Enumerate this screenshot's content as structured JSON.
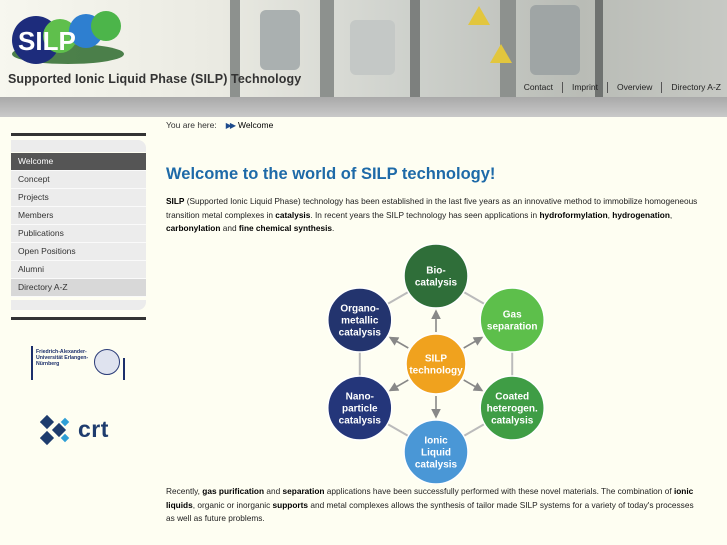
{
  "header": {
    "logo_text": "SILP",
    "site_title": "Supported Ionic Liquid Phase (SILP) Technology",
    "nav": [
      "Contact",
      "Imprint",
      "Overview",
      "Directory A-Z"
    ]
  },
  "breadcrumb": {
    "prefix": "You are here:",
    "current": "Welcome"
  },
  "sidebar": {
    "items": [
      {
        "label": "Welcome"
      },
      {
        "label": "Concept"
      },
      {
        "label": "Projects"
      },
      {
        "label": "Members"
      },
      {
        "label": "Publications"
      },
      {
        "label": "Open Positions"
      },
      {
        "label": "Alumni"
      },
      {
        "label": "Directory A-Z"
      }
    ],
    "fau_logo_text": "Friedrich-Alexander-Universität Erlangen-Nürnberg",
    "crt_logo_text": "crt"
  },
  "main": {
    "title": "Welcome to the world of SILP technology!",
    "p1": [
      {
        "t": "SILP",
        "b": true
      },
      {
        "t": " (Supported Ionic Liquid Phase) technology has been established in the last five years as an innovative method to immobilize homogeneous transition metal complexes in ",
        "b": false
      },
      {
        "t": "catalysis",
        "b": true
      },
      {
        "t": ". In recent years the SILP technology has seen applications in ",
        "b": false
      },
      {
        "t": "hydroformylation",
        "b": true
      },
      {
        "t": ", ",
        "b": false
      },
      {
        "t": "hydrogenation",
        "b": true
      },
      {
        "t": ", ",
        "b": false
      },
      {
        "t": "carbonylation",
        "b": true
      },
      {
        "t": " and ",
        "b": false
      },
      {
        "t": "fine chemical synthesis",
        "b": true
      },
      {
        "t": ".",
        "b": false
      }
    ],
    "p2": [
      {
        "t": "Recently, ",
        "b": false
      },
      {
        "t": "gas purification",
        "b": true
      },
      {
        "t": " and ",
        "b": false
      },
      {
        "t": "separation",
        "b": true
      },
      {
        "t": " applications have been successfully performed with these novel materials. The combination of ",
        "b": false
      },
      {
        "t": "ionic liquids",
        "b": true
      },
      {
        "t": ", organic or inorganic ",
        "b": false
      },
      {
        "t": "supports",
        "b": true
      },
      {
        "t": " and metal complexes allows the synthesis of tailor made SILP systems for a variety of today's processes as well as future problems.",
        "b": false
      }
    ],
    "diagram": {
      "center": {
        "lines": [
          "SILP",
          "technology"
        ],
        "color": "#f0a21e"
      },
      "nodes": [
        {
          "lines": [
            "Bio-",
            "catalysis"
          ],
          "color": "#2f6e39"
        },
        {
          "lines": [
            "Gas",
            "separation"
          ],
          "color": "#5dbf4b"
        },
        {
          "lines": [
            "Coated",
            "heterogen.",
            "catalysis"
          ],
          "color": "#3f9d45"
        },
        {
          "lines": [
            "Ionic",
            "Liquid",
            "catalysis"
          ],
          "color": "#4a97d6"
        },
        {
          "lines": [
            "Nano-",
            "particle",
            "catalysis"
          ],
          "color": "#24367a"
        },
        {
          "lines": [
            "Organo-",
            "metallic",
            "catalysis"
          ],
          "color": "#23346e"
        }
      ]
    }
  }
}
